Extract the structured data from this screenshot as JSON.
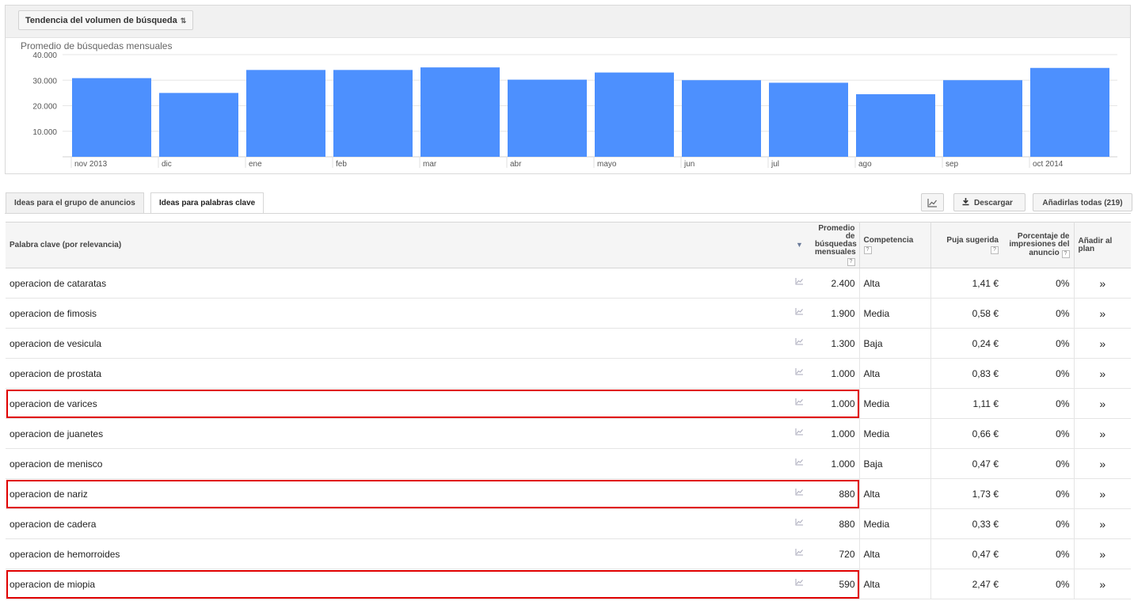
{
  "chart_toolbar": {
    "select_label": "Tendencia del volumen de búsqueda",
    "select_icon": "sort-updown-icon"
  },
  "chart_data": {
    "type": "bar",
    "title": "Promedio de búsquedas mensuales",
    "categories": [
      "nov 2013",
      "dic",
      "ene",
      "feb",
      "mar",
      "abr",
      "mayo",
      "jun",
      "jul",
      "ago",
      "sep",
      "oct 2014"
    ],
    "values": [
      30800,
      25000,
      34000,
      34000,
      35000,
      30200,
      33000,
      30000,
      29000,
      24500,
      30000,
      34800
    ],
    "yticks": [
      "10.000",
      "20.000",
      "30.000",
      "40.000"
    ],
    "ylim": [
      0,
      40000
    ],
    "bar_color": "#4d90fe",
    "grid": true
  },
  "tabs": [
    {
      "label": "Ideas para el grupo de anuncios",
      "active": false
    },
    {
      "label": "Ideas para palabras clave",
      "active": true
    }
  ],
  "toolbar": {
    "chart_icon": "line-chart-icon",
    "download_icon": "download-icon",
    "download_label": "Descargar",
    "add_all_label": "Añadirlas todas (219)"
  },
  "table": {
    "headers": {
      "keyword": "Palabra clave (por relevancia)",
      "avg_line1": "Promedio de",
      "avg_line2": "búsquedas",
      "avg_line3": "mensuales",
      "competition": "Competencia",
      "bid": "Puja sugerida",
      "impr_line1": "Porcentaje de",
      "impr_line2": "impresiones del",
      "impr_line3": "anuncio",
      "add_line1": "Añadir al",
      "add_line2": "plan",
      "help": "?",
      "sort": "▼"
    },
    "rows": [
      {
        "keyword": "operacion de cataratas",
        "searches": "2.400",
        "competition": "Alta",
        "bid": "1,41 €",
        "impr": "0%",
        "highlight": false
      },
      {
        "keyword": "operacion de fimosis",
        "searches": "1.900",
        "competition": "Media",
        "bid": "0,58 €",
        "impr": "0%",
        "highlight": false
      },
      {
        "keyword": "operacion de vesicula",
        "searches": "1.300",
        "competition": "Baja",
        "bid": "0,24 €",
        "impr": "0%",
        "highlight": false
      },
      {
        "keyword": "operacion de prostata",
        "searches": "1.000",
        "competition": "Alta",
        "bid": "0,83 €",
        "impr": "0%",
        "highlight": false
      },
      {
        "keyword": "operacion de varices",
        "searches": "1.000",
        "competition": "Media",
        "bid": "1,11 €",
        "impr": "0%",
        "highlight": true
      },
      {
        "keyword": "operacion de juanetes",
        "searches": "1.000",
        "competition": "Media",
        "bid": "0,66 €",
        "impr": "0%",
        "highlight": false
      },
      {
        "keyword": "operacion de menisco",
        "searches": "1.000",
        "competition": "Baja",
        "bid": "0,47 €",
        "impr": "0%",
        "highlight": false
      },
      {
        "keyword": "operacion de nariz",
        "searches": "880",
        "competition": "Alta",
        "bid": "1,73 €",
        "impr": "0%",
        "highlight": true
      },
      {
        "keyword": "operacion de cadera",
        "searches": "880",
        "competition": "Media",
        "bid": "0,33 €",
        "impr": "0%",
        "highlight": false
      },
      {
        "keyword": "operacion de hemorroides",
        "searches": "720",
        "competition": "Alta",
        "bid": "0,47 €",
        "impr": "0%",
        "highlight": false
      },
      {
        "keyword": "operacion de miopia",
        "searches": "590",
        "competition": "Alta",
        "bid": "2,47 €",
        "impr": "0%",
        "highlight": true
      }
    ],
    "trend_icon": "mini-chart-icon",
    "add_icon": "chevron-right-double-icon"
  },
  "colors": {
    "highlight_border": "#e00000",
    "bar": "#4d90fe"
  }
}
